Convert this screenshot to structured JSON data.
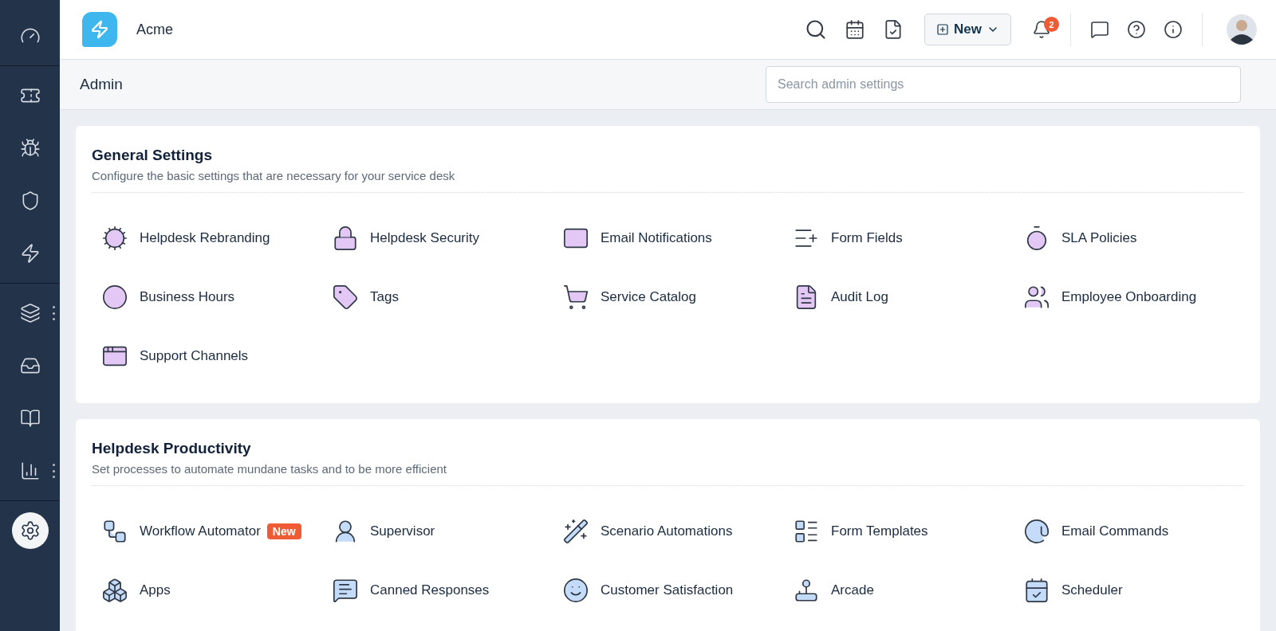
{
  "app": {
    "name": "Acme"
  },
  "sidebar": {
    "groups": [
      {
        "items": [
          {
            "selected": false,
            "has_menu": false
          }
        ]
      },
      {
        "items": [
          {
            "selected": false,
            "has_menu": false
          },
          {
            "selected": false,
            "has_menu": false
          },
          {
            "selected": false,
            "has_menu": false
          },
          {
            "selected": false,
            "has_menu": false
          }
        ]
      },
      {
        "items": [
          {
            "selected": false,
            "has_menu": true
          },
          {
            "selected": false,
            "has_menu": false
          },
          {
            "selected": false,
            "has_menu": false
          },
          {
            "selected": false,
            "has_menu": true
          }
        ]
      },
      {
        "items": [
          {
            "selected": true,
            "has_menu": false
          }
        ]
      }
    ]
  },
  "header": {
    "new_button": {
      "label": "New"
    },
    "notifications": {
      "badge": "2"
    }
  },
  "page": {
    "title": "Admin",
    "search": {
      "placeholder": "Search admin settings"
    }
  },
  "sections": [
    {
      "title": "General Settings",
      "description": "Configure the basic settings that are necessary for your service desk",
      "items": [
        {
          "label": "Helpdesk Rebranding"
        },
        {
          "label": "Helpdesk Security"
        },
        {
          "label": "Email Notifications"
        },
        {
          "label": "Form Fields"
        },
        {
          "label": "SLA Policies"
        },
        {
          "label": "Business Hours"
        },
        {
          "label": "Tags"
        },
        {
          "label": "Service Catalog"
        },
        {
          "label": "Audit Log"
        },
        {
          "label": "Employee Onboarding"
        },
        {
          "label": "Support Channels"
        }
      ]
    },
    {
      "title": "Helpdesk Productivity",
      "description": "Set processes to automate mundane tasks and to be more efficient",
      "items": [
        {
          "label": "Workflow Automator",
          "badge": "New"
        },
        {
          "label": "Supervisor"
        },
        {
          "label": "Scenario Automations"
        },
        {
          "label": "Form Templates"
        },
        {
          "label": "Email Commands"
        },
        {
          "label": "Apps"
        },
        {
          "label": "Canned Responses"
        },
        {
          "label": "Customer Satisfaction"
        },
        {
          "label": "Arcade"
        },
        {
          "label": "Scheduler"
        }
      ]
    }
  ]
}
